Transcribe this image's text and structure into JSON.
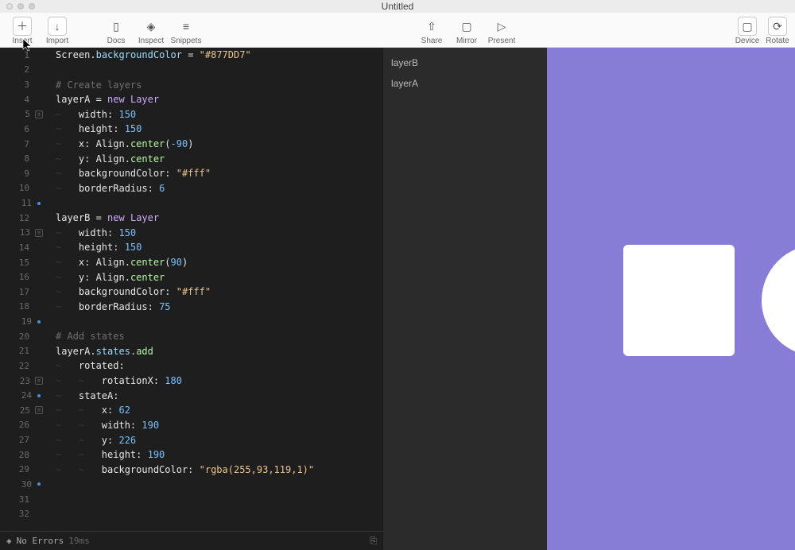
{
  "window": {
    "title": "Untitled"
  },
  "toolbar": {
    "insert": "Insert",
    "import": "Import",
    "docs": "Docs",
    "inspect": "Inspect",
    "snippets": "Snippets",
    "share": "Share",
    "mirror": "Mirror",
    "present": "Present",
    "device": "Device",
    "rotate": "Rotate"
  },
  "layers": {
    "items": [
      "layerB",
      "layerA"
    ]
  },
  "footer": {
    "errors": "No Errors",
    "time": "19ms"
  },
  "preview": {
    "backgroundColor": "#877DD7"
  },
  "code": {
    "gutter_start": 1,
    "marks": {
      "5": "square",
      "13": "square",
      "23": "square",
      "25": "square",
      "11": "dot",
      "19": "dot",
      "24": "dot",
      "30": "dot"
    },
    "lines": [
      [
        {
          "c": "ident",
          "t": "Screen"
        },
        {
          "c": "plain",
          "t": "."
        },
        {
          "c": "prop",
          "t": "backgroundColor"
        },
        {
          "c": "plain",
          "t": " = "
        },
        {
          "c": "string",
          "t": "\"#877DD7\""
        }
      ],
      [],
      [
        {
          "c": "comment",
          "t": "# Create layers"
        }
      ],
      [
        {
          "c": "ident",
          "t": "layerA"
        },
        {
          "c": "plain",
          "t": " = "
        },
        {
          "c": "keyword",
          "t": "new"
        },
        {
          "c": "plain",
          "t": " "
        },
        {
          "c": "class",
          "t": "Layer"
        }
      ],
      [
        {
          "c": "indent",
          "t": "~   "
        },
        {
          "c": "plain",
          "t": "width: "
        },
        {
          "c": "number",
          "t": "150"
        }
      ],
      [
        {
          "c": "indent",
          "t": "~   "
        },
        {
          "c": "plain",
          "t": "height: "
        },
        {
          "c": "number",
          "t": "150"
        }
      ],
      [
        {
          "c": "indent",
          "t": "~   "
        },
        {
          "c": "plain",
          "t": "x: Align."
        },
        {
          "c": "func",
          "t": "center"
        },
        {
          "c": "plain",
          "t": "("
        },
        {
          "c": "number",
          "t": "-90"
        },
        {
          "c": "plain",
          "t": ")"
        }
      ],
      [
        {
          "c": "indent",
          "t": "~   "
        },
        {
          "c": "plain",
          "t": "y: Align."
        },
        {
          "c": "func",
          "t": "center"
        }
      ],
      [
        {
          "c": "indent",
          "t": "~   "
        },
        {
          "c": "plain",
          "t": "backgroundColor: "
        },
        {
          "c": "string",
          "t": "\"#fff\""
        }
      ],
      [
        {
          "c": "indent",
          "t": "~   "
        },
        {
          "c": "plain",
          "t": "borderRadius: "
        },
        {
          "c": "number",
          "t": "6"
        }
      ],
      [],
      [
        {
          "c": "ident",
          "t": "layerB"
        },
        {
          "c": "plain",
          "t": " = "
        },
        {
          "c": "keyword",
          "t": "new"
        },
        {
          "c": "plain",
          "t": " "
        },
        {
          "c": "class",
          "t": "Layer"
        }
      ],
      [
        {
          "c": "indent",
          "t": "~   "
        },
        {
          "c": "plain",
          "t": "width: "
        },
        {
          "c": "number",
          "t": "150"
        }
      ],
      [
        {
          "c": "indent",
          "t": "~   "
        },
        {
          "c": "plain",
          "t": "height: "
        },
        {
          "c": "number",
          "t": "150"
        }
      ],
      [
        {
          "c": "indent",
          "t": "~   "
        },
        {
          "c": "plain",
          "t": "x: Align."
        },
        {
          "c": "func",
          "t": "center"
        },
        {
          "c": "plain",
          "t": "("
        },
        {
          "c": "number",
          "t": "90"
        },
        {
          "c": "plain",
          "t": ")"
        }
      ],
      [
        {
          "c": "indent",
          "t": "~   "
        },
        {
          "c": "plain",
          "t": "y: Align."
        },
        {
          "c": "func",
          "t": "center"
        }
      ],
      [
        {
          "c": "indent",
          "t": "~   "
        },
        {
          "c": "plain",
          "t": "backgroundColor: "
        },
        {
          "c": "string",
          "t": "\"#fff\""
        }
      ],
      [
        {
          "c": "indent",
          "t": "~   "
        },
        {
          "c": "plain",
          "t": "borderRadius: "
        },
        {
          "c": "number",
          "t": "75"
        }
      ],
      [],
      [
        {
          "c": "comment",
          "t": "# Add states"
        }
      ],
      [
        {
          "c": "ident",
          "t": "layerA"
        },
        {
          "c": "plain",
          "t": "."
        },
        {
          "c": "prop",
          "t": "states"
        },
        {
          "c": "plain",
          "t": "."
        },
        {
          "c": "func",
          "t": "add"
        }
      ],
      [
        {
          "c": "indent",
          "t": "~   "
        },
        {
          "c": "plain",
          "t": "rotated:"
        }
      ],
      [
        {
          "c": "indent",
          "t": "~   ~   "
        },
        {
          "c": "plain",
          "t": "rotationX: "
        },
        {
          "c": "number",
          "t": "180"
        }
      ],
      [
        {
          "c": "indent",
          "t": "~   "
        },
        {
          "c": "plain",
          "t": "stateA:"
        }
      ],
      [
        {
          "c": "indent",
          "t": "~   ~   "
        },
        {
          "c": "plain",
          "t": "x: "
        },
        {
          "c": "number",
          "t": "62"
        }
      ],
      [
        {
          "c": "indent",
          "t": "~   ~   "
        },
        {
          "c": "plain",
          "t": "width: "
        },
        {
          "c": "number",
          "t": "190"
        }
      ],
      [
        {
          "c": "indent",
          "t": "~   ~   "
        },
        {
          "c": "plain",
          "t": "y: "
        },
        {
          "c": "number",
          "t": "226"
        }
      ],
      [
        {
          "c": "indent",
          "t": "~   ~   "
        },
        {
          "c": "plain",
          "t": "height: "
        },
        {
          "c": "number",
          "t": "190"
        }
      ],
      [
        {
          "c": "indent",
          "t": "~   ~   "
        },
        {
          "c": "plain",
          "t": "backgroundColor: "
        },
        {
          "c": "string",
          "t": "\"rgba(255,93,119,1)\""
        }
      ],
      [],
      [],
      []
    ]
  }
}
